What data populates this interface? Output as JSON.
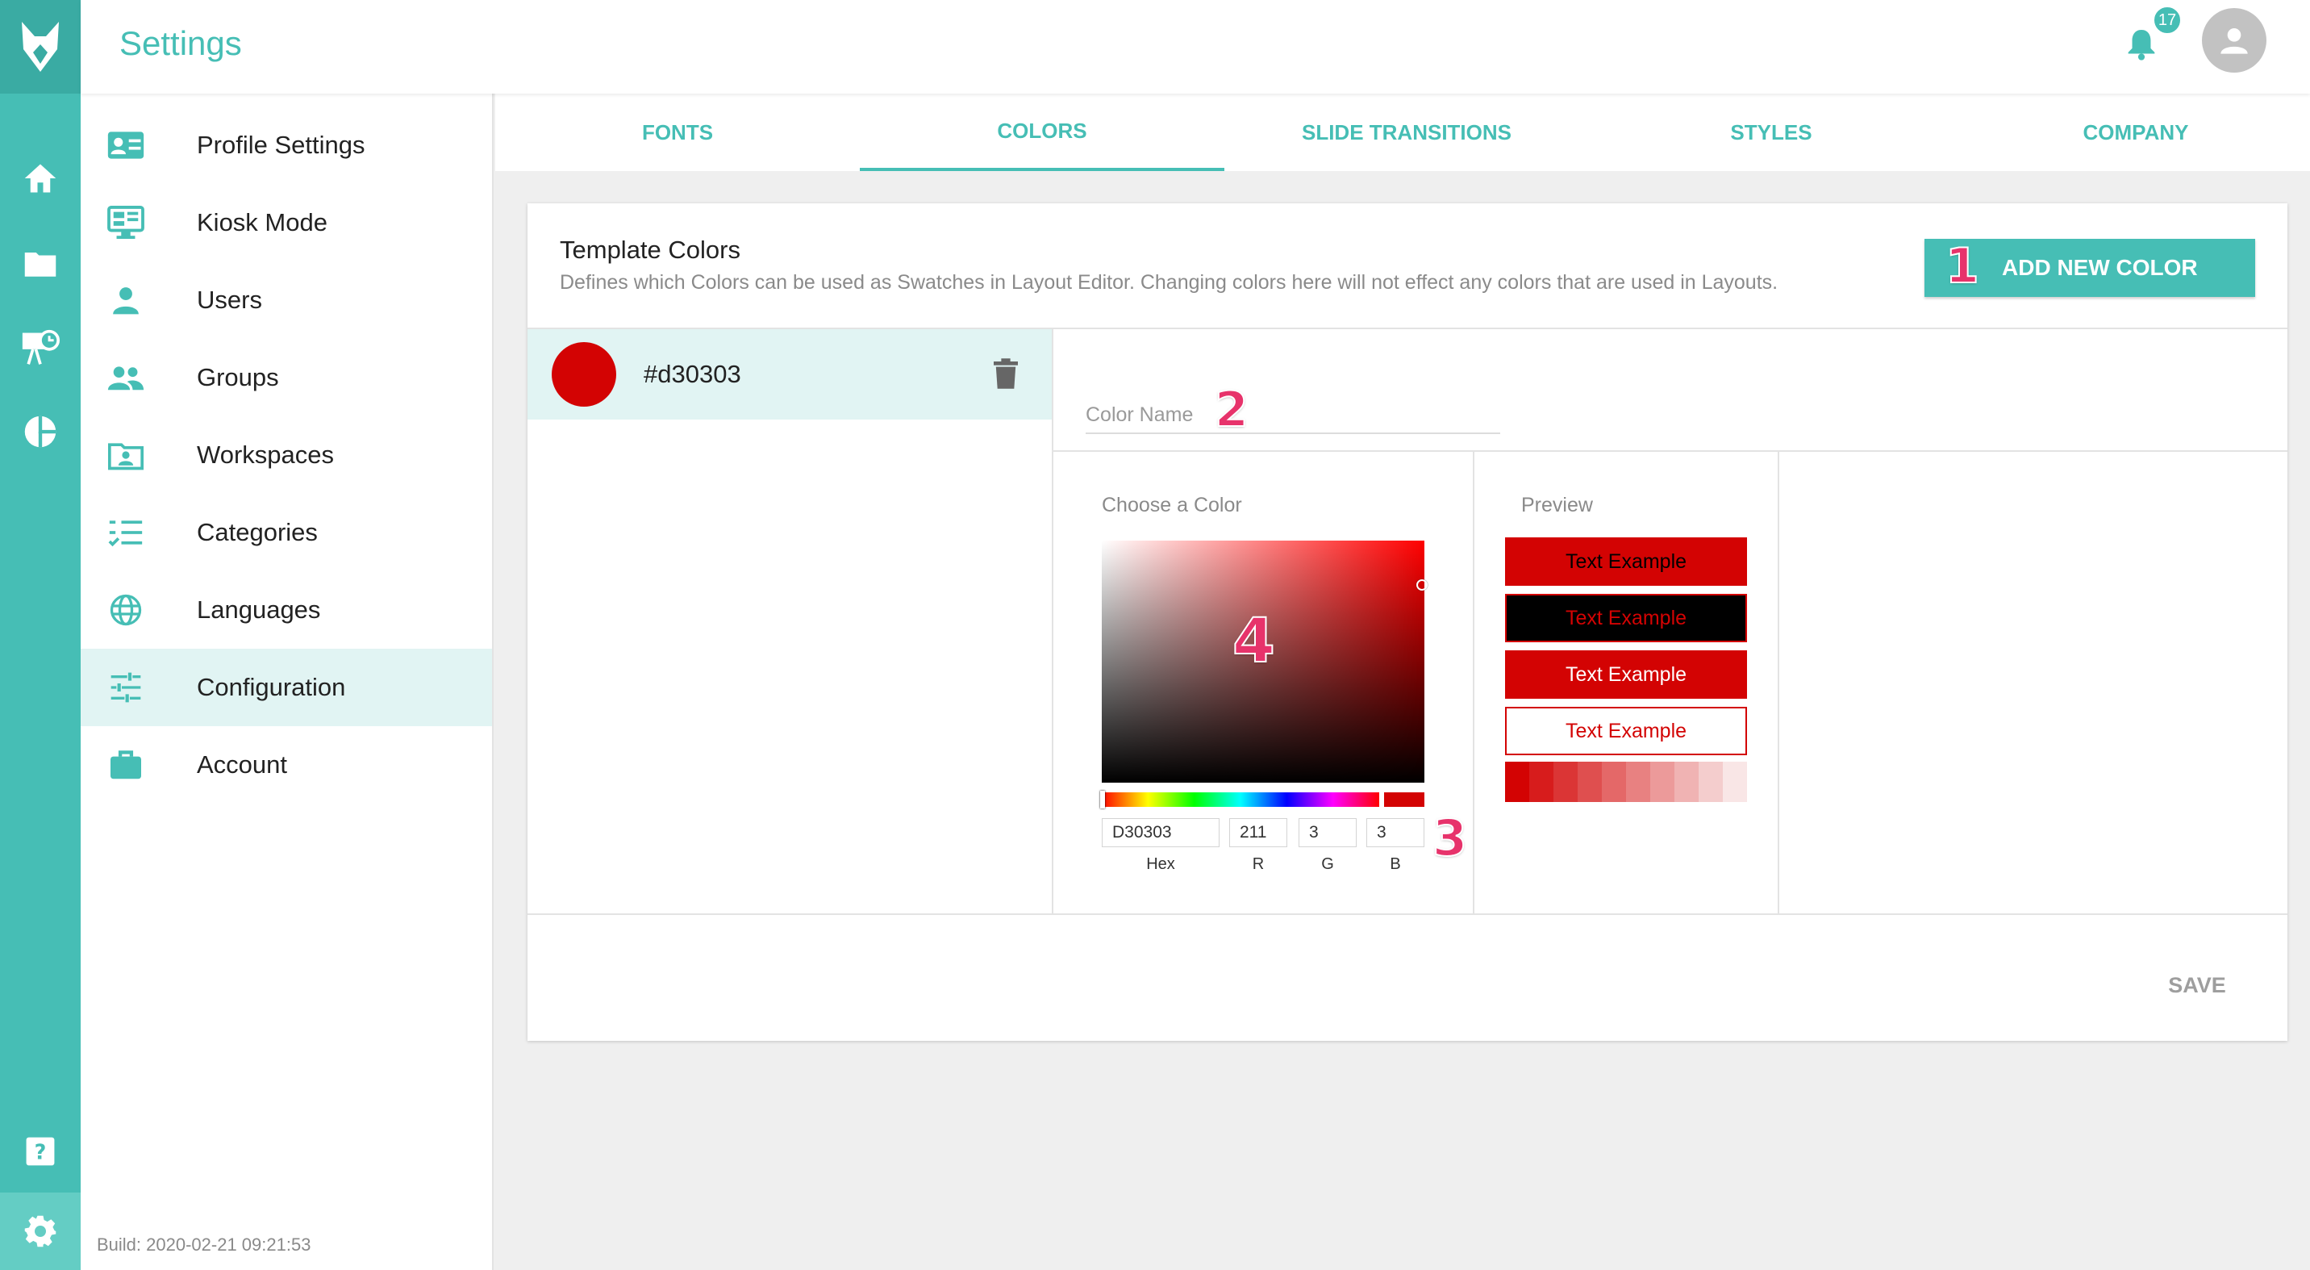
{
  "app": {
    "page_title": "Settings",
    "notification_count": "17",
    "logo_icon": "fox-logo-icon",
    "brand_color": "#46beb5"
  },
  "rail": {
    "items": [
      {
        "icon": "home-icon"
      },
      {
        "icon": "folder-icon"
      },
      {
        "icon": "presentation-icon"
      },
      {
        "icon": "pie-chart-icon"
      },
      {
        "icon": "help-icon"
      },
      {
        "icon": "gear-icon"
      }
    ]
  },
  "nav": {
    "items": [
      {
        "label": "Profile Settings",
        "icon": "id-card-icon"
      },
      {
        "label": "Kiosk Mode",
        "icon": "monitor-icon"
      },
      {
        "label": "Users",
        "icon": "user-icon"
      },
      {
        "label": "Groups",
        "icon": "group-icon"
      },
      {
        "label": "Workspaces",
        "icon": "workspace-icon"
      },
      {
        "label": "Categories",
        "icon": "checklist-icon"
      },
      {
        "label": "Languages",
        "icon": "globe-icon"
      },
      {
        "label": "Configuration",
        "icon": "sliders-icon"
      },
      {
        "label": "Account",
        "icon": "briefcase-icon"
      }
    ],
    "active": "Configuration",
    "build": "Build: 2020-02-21 09:21:53"
  },
  "tabs": [
    {
      "label": "FONTS"
    },
    {
      "label": "COLORS"
    },
    {
      "label": "SLIDE TRANSITIONS"
    },
    {
      "label": "STYLES"
    },
    {
      "label": "COMPANY"
    }
  ],
  "active_tab": "COLORS",
  "template_colors": {
    "title": "Template Colors",
    "description": "Defines which Colors can be used as Swatches in Layout Editor. Changing colors here will not effect any colors that are used in Layouts.",
    "add_button": "ADD NEW COLOR",
    "swatches": [
      {
        "label": "#d30303",
        "color": "#d30303"
      }
    ],
    "color_name": {
      "placeholder": "Color Name",
      "value": ""
    }
  },
  "picker": {
    "label": "Choose a Color",
    "hex": "D30303",
    "r": "211",
    "g": "3",
    "b": "3",
    "hex_label": "Hex",
    "r_label": "R",
    "g_label": "G",
    "b_label": "B"
  },
  "preview": {
    "label": "Preview",
    "example_text": "Text Example",
    "shades": [
      "#d30303",
      "#d71c1c",
      "#db3535",
      "#df4f4f",
      "#e46868",
      "#e88181",
      "#ec9a9a",
      "#f0b3b3",
      "#f4cdcd",
      "#f9e6e6"
    ]
  },
  "annotations": [
    "1",
    "2",
    "3",
    "4"
  ],
  "save_label": "SAVE"
}
